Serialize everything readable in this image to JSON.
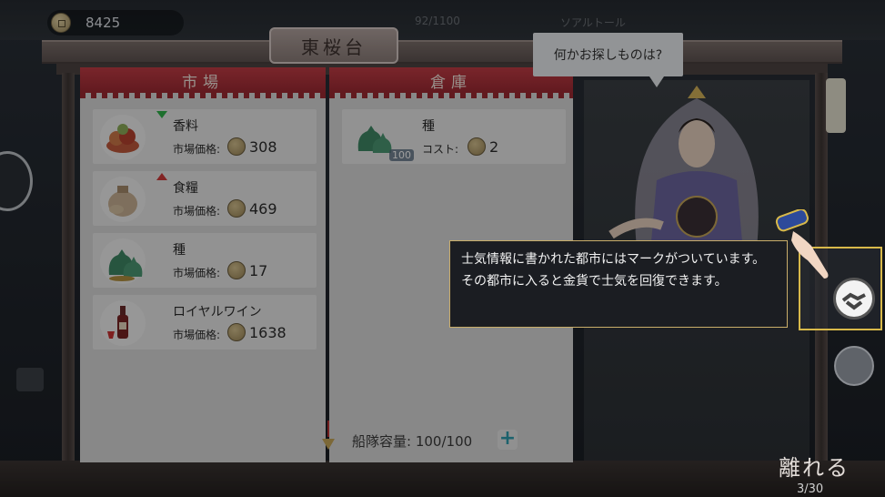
{
  "top": {
    "gold": "8425",
    "faded_center": "92/1100",
    "faded_right": "ソアルトール"
  },
  "location": {
    "title": "東桜台"
  },
  "market": {
    "heading": "市場",
    "price_label": "市場価格:",
    "items": [
      {
        "name": "香料",
        "price": "308",
        "trend": "down",
        "icon": "spice-icon"
      },
      {
        "name": "食糧",
        "price": "469",
        "trend": "up",
        "icon": "food-sack-icon"
      },
      {
        "name": "種",
        "price": "17",
        "trend": "",
        "icon": "seed-bag-icon"
      },
      {
        "name": "ロイヤルワイン",
        "price": "1638",
        "trend": "",
        "icon": "wine-icon"
      }
    ]
  },
  "warehouse": {
    "heading": "倉庫",
    "cost_label": "コスト:",
    "items": [
      {
        "name": "種",
        "cost": "2",
        "qty": "100",
        "icon": "seed-bag-icon"
      }
    ],
    "capacity_label": "船隊容量:",
    "capacity": "100/100"
  },
  "npc": {
    "speech": "何かお探しものは?"
  },
  "tutorial": {
    "text": "士気情報に書かれた都市にはマークがついています。その都市に入ると金貨で士気を回復できます。"
  },
  "actions": {
    "leave": "離れる",
    "counter": "3/30"
  },
  "colors": {
    "accent_red": "#b3323c",
    "highlight_gold": "#d8b94a",
    "trend_down": "#2fb34a",
    "trend_up": "#d23b3b"
  }
}
